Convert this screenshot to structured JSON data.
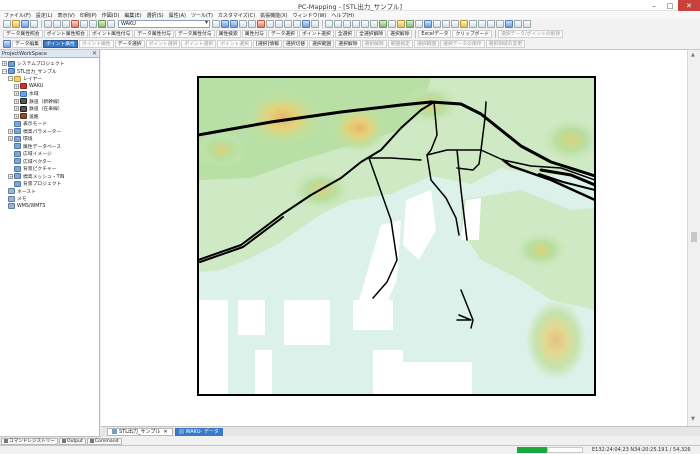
{
  "window": {
    "title": "PC-Mapping - [STL出力_サンプル]",
    "min_glyph": "–",
    "max_glyph": "□",
    "close_glyph": "✕"
  },
  "menu": [
    "ファイル(F)",
    "設定(L)",
    "表示(V)",
    "印刷(P)",
    "作図(D)",
    "編集(E)",
    "選択(S)",
    "属性(A)",
    "ツール(T)",
    "カスタマイズ(C)",
    "拡張機能(X)",
    "ウィンドウ(W)",
    "ヘルプ(H)"
  ],
  "toolbar1": {
    "layer_select": "WAKU"
  },
  "toolbar2": {
    "buttons": [
      "データ属性照会",
      "ポイント属性照会",
      "ポイント属性付与",
      "データ属性付与",
      "データ属性付与",
      "属性検索",
      "属性付与",
      "データ選択",
      "ポイント選択",
      "全選択",
      "全選択解除",
      "選択解除"
    ],
    "dropdowns": [
      "Excelデータ",
      "クリップボード"
    ],
    "right_button": "選択データ/ポイントの削除"
  },
  "toolbar3": {
    "buttons": [
      "データ編集",
      "ポイント属性",
      "ポイント属性",
      "データ選択",
      "ポイント選択",
      "ポイント選択",
      "ポイント選択",
      "[選択]情報",
      "選択切替",
      "選択範囲",
      "選択解除",
      "選択解除",
      "範囲指定",
      "選択範囲",
      "選択データの保存",
      "選択領域の変更"
    ]
  },
  "workspace": {
    "title": "ProjectWorkSpace",
    "pin_glyph": "✕",
    "tree": [
      {
        "label": "システムプロジェクト",
        "icon": "project-icon",
        "indent": 0,
        "expander": "+"
      },
      {
        "label": "STL出力_サンプル",
        "icon": "project-icon",
        "indent": 0,
        "expander": "−"
      },
      {
        "label": "レイヤー",
        "icon": "folder-icon",
        "indent": 1,
        "expander": "−"
      },
      {
        "label": "WAKU",
        "icon": "waku-layer-icon",
        "indent": 2,
        "expander": "+"
      },
      {
        "label": "水域",
        "icon": "water-layer-icon",
        "indent": 2,
        "expander": "+"
      },
      {
        "label": "鉄道（新幹線）",
        "icon": "rail-layer-icon",
        "indent": 2,
        "expander": "+"
      },
      {
        "label": "鉄道（在来線）",
        "icon": "rail-layer-icon",
        "indent": 2,
        "expander": "+"
      },
      {
        "label": "道路",
        "icon": "road-layer-icon",
        "indent": 2,
        "expander": "+"
      },
      {
        "label": "表示モード",
        "icon": "node-icon",
        "indent": 1,
        "expander": ""
      },
      {
        "label": "標高パラメーター",
        "icon": "node-icon",
        "indent": 1,
        "expander": "+"
      },
      {
        "label": "環境",
        "icon": "node-icon",
        "indent": 1,
        "expander": "+"
      },
      {
        "label": "属性データベース",
        "icon": "node-icon",
        "indent": 1,
        "expander": ""
      },
      {
        "label": "広域イメージ",
        "icon": "node-icon",
        "indent": 1,
        "expander": ""
      },
      {
        "label": "広域ベクター",
        "icon": "node-icon",
        "indent": 1,
        "expander": ""
      },
      {
        "label": "背景ピクチャー",
        "icon": "node-icon",
        "indent": 1,
        "expander": ""
      },
      {
        "label": "標高メッシュ・TIN",
        "icon": "node-icon",
        "indent": 1,
        "expander": "+"
      },
      {
        "label": "背景プロジェクト",
        "icon": "node-icon",
        "indent": 1,
        "expander": ""
      },
      {
        "label": "ネースト",
        "icon": "misc-icon",
        "indent": 0,
        "expander": ""
      },
      {
        "label": "メモ",
        "icon": "misc-icon",
        "indent": 0,
        "expander": ""
      },
      {
        "label": "WMS/WMTS",
        "icon": "misc-icon",
        "indent": 0,
        "expander": ""
      }
    ]
  },
  "doc_tabs": [
    {
      "label": "STL出力_サンプル",
      "close": "✕",
      "state": "active"
    },
    {
      "label": "WAKU- データ",
      "state": "inactive"
    }
  ],
  "left_tabs": [
    "コマンドレジストリー",
    "Output",
    "Command"
  ],
  "status": {
    "progress": 0.45,
    "coords": "E132:24:04.23 N34:20:25.19",
    "scale": "1 / 54,326"
  },
  "colors": {
    "relief_green": "#a9d7a2",
    "relief_orange": "#e9b56b",
    "water_mint": "#dcf1ea",
    "route_black": "#000000",
    "progress_green": "#19a83c",
    "accent_blue": "#3a78c8"
  },
  "icons": {
    "map_scroll_up": "▲",
    "map_scroll_down": "▼"
  }
}
